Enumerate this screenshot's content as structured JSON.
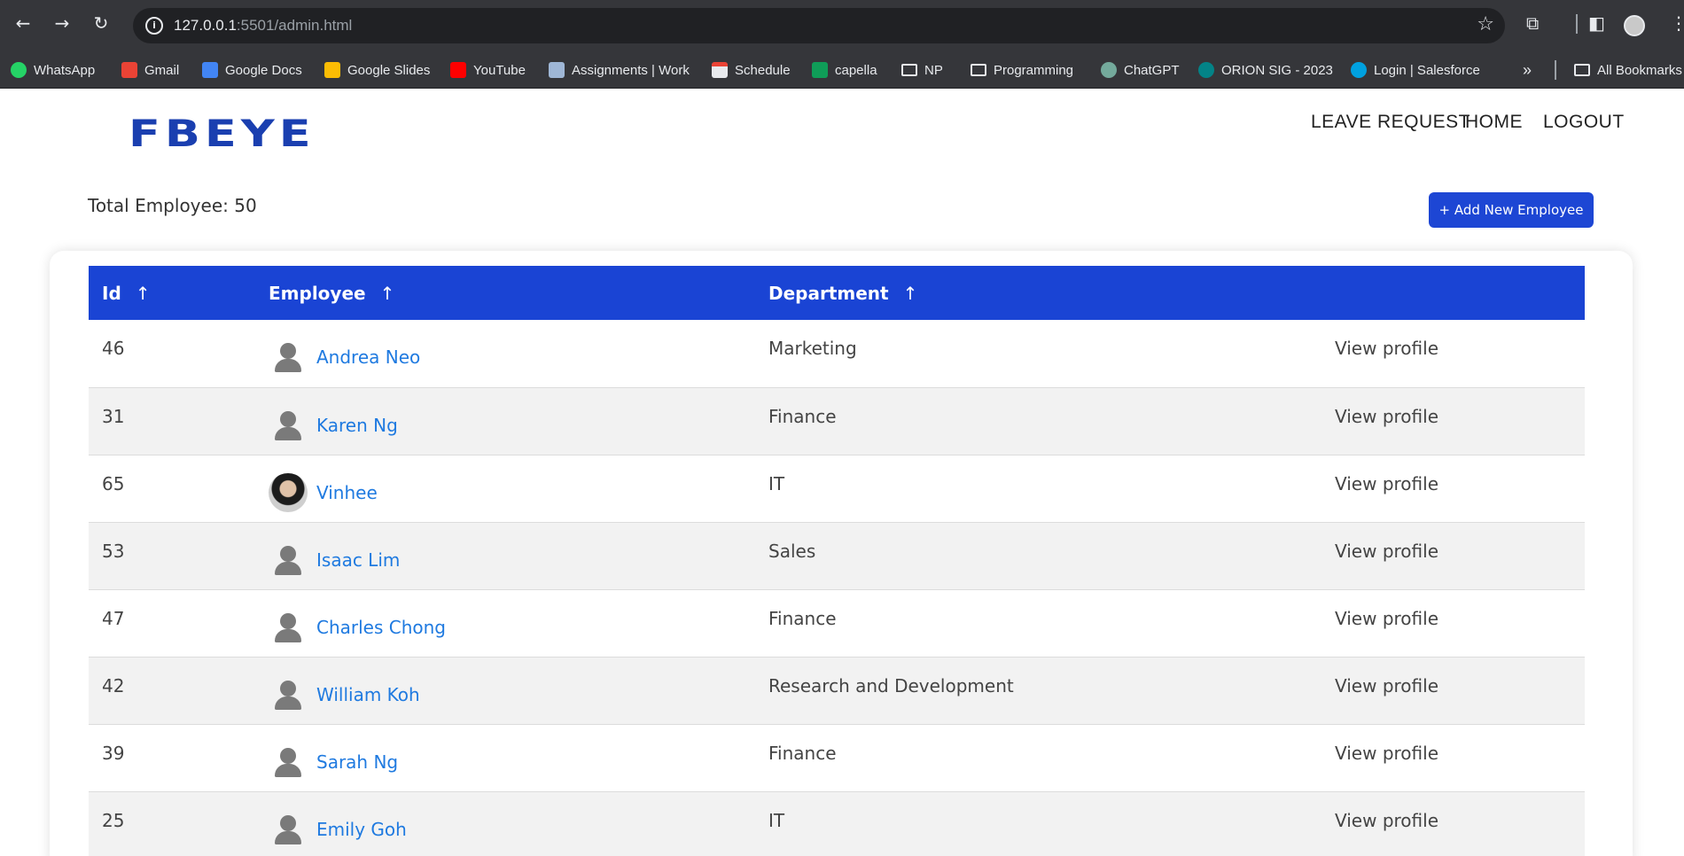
{
  "browser": {
    "url_host": "127.0.0.1",
    "url_rest": ":5501/admin.html",
    "bookmarks": [
      {
        "label": "WhatsApp",
        "icon": "whatsapp-icon",
        "color": "#25d366"
      },
      {
        "label": "Gmail",
        "icon": "gmail-icon",
        "color": "#ea4335"
      },
      {
        "label": "Google Docs",
        "icon": "google-docs-icon",
        "color": "#4285f4"
      },
      {
        "label": "Google Slides",
        "icon": "google-slides-icon",
        "color": "#fbbc04"
      },
      {
        "label": "YouTube",
        "icon": "youtube-icon",
        "color": "#ff0000"
      },
      {
        "label": "Assignments | Work",
        "icon": "book-icon",
        "color": "#9fb7d6"
      },
      {
        "label": "Schedule",
        "icon": "calendar-icon",
        "color": "#e8eaed"
      },
      {
        "label": "capella",
        "icon": "sheets-icon",
        "color": "#0f9d58"
      },
      {
        "label": "NP",
        "icon": "folder-icon",
        "color": ""
      },
      {
        "label": "Programming",
        "icon": "folder-icon",
        "color": ""
      },
      {
        "label": "ChatGPT",
        "icon": "chatgpt-icon",
        "color": "#74aa9c"
      },
      {
        "label": "ORION SIG - 2023",
        "icon": "sharepoint-icon",
        "color": "#038387"
      },
      {
        "label": "Login | Salesforce",
        "icon": "salesforce-icon",
        "color": "#00a1e0"
      }
    ],
    "all_bookmarks": "All Bookmarks"
  },
  "header": {
    "logo": "FBEYE",
    "nav": [
      "LEAVE REQUEST",
      "HOME",
      "LOGOUT"
    ]
  },
  "summary": {
    "total_label": "Total Employee: 50",
    "add_button": "+ Add New Employee"
  },
  "table": {
    "columns": [
      "Id",
      "Employee",
      "Department"
    ],
    "sort_arrow": "↑",
    "action_label": "View profile",
    "rows": [
      {
        "id": "46",
        "name": "Andrea Neo",
        "department": "Marketing",
        "avatar": "placeholder"
      },
      {
        "id": "31",
        "name": "Karen Ng",
        "department": "Finance",
        "avatar": "placeholder"
      },
      {
        "id": "65",
        "name": "Vinhee",
        "department": "IT",
        "avatar": "photo"
      },
      {
        "id": "53",
        "name": "Isaac Lim",
        "department": "Sales",
        "avatar": "placeholder"
      },
      {
        "id": "47",
        "name": "Charles Chong",
        "department": "Finance",
        "avatar": "placeholder"
      },
      {
        "id": "42",
        "name": "William Koh",
        "department": "Research and Development",
        "avatar": "placeholder"
      },
      {
        "id": "39",
        "name": "Sarah Ng",
        "department": "Finance",
        "avatar": "placeholder"
      },
      {
        "id": "25",
        "name": "Emily Goh",
        "department": "IT",
        "avatar": "placeholder"
      }
    ]
  },
  "colors": {
    "accent": "#1a44d4",
    "link": "#1f7ae0",
    "logo": "#1a3fb0"
  }
}
